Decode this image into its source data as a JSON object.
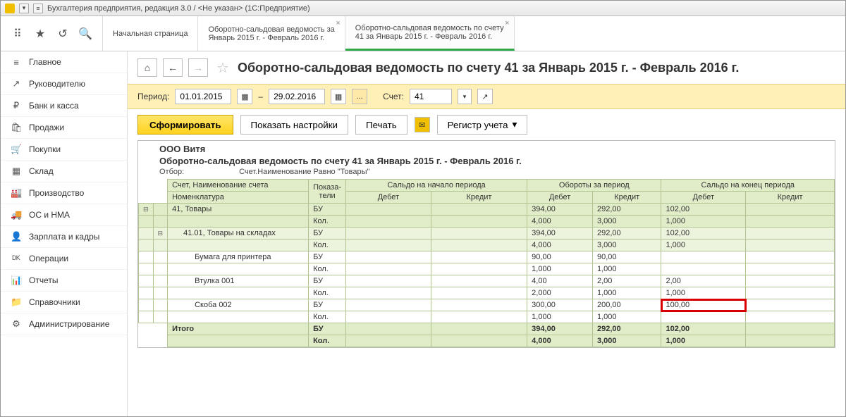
{
  "window_title": "Бухгалтерия предприятия, редакция 3.0 / <Не указан> (1С:Предприятие)",
  "toolbar_icons": [
    "grid",
    "star",
    "link",
    "search"
  ],
  "tabs": [
    {
      "l1": "Начальная страница",
      "l2": ""
    },
    {
      "l1": "Оборотно-сальдовая ведомость за",
      "l2": "Январь 2015 г. - Февраль 2016 г."
    },
    {
      "l1": "Оборотно-сальдовая ведомость по счету",
      "l2": "41 за Январь 2015 г. - Февраль 2016 г."
    }
  ],
  "sidebar": [
    {
      "icon": "≡",
      "label": "Главное"
    },
    {
      "icon": "↗",
      "label": "Руководителю"
    },
    {
      "icon": "₽",
      "label": "Банк и касса"
    },
    {
      "icon": "🛍",
      "label": "Продажи"
    },
    {
      "icon": "🛒",
      "label": "Покупки"
    },
    {
      "icon": "▦",
      "label": "Склад"
    },
    {
      "icon": "🏭",
      "label": "Производство"
    },
    {
      "icon": "🚚",
      "label": "ОС и НМА"
    },
    {
      "icon": "👤",
      "label": "Зарплата и кадры"
    },
    {
      "icon": "ᴰᴷ",
      "label": "Операции"
    },
    {
      "icon": "📊",
      "label": "Отчеты"
    },
    {
      "icon": "📁",
      "label": "Справочники"
    },
    {
      "icon": "⚙",
      "label": "Администрирование"
    }
  ],
  "page_title": "Оборотно-сальдовая ведомость по счету 41 за Январь 2015 г. - Февраль 2016 г.",
  "params": {
    "period_label": "Период:",
    "from": "01.01.2015",
    "dash": "–",
    "to": "29.02.2016",
    "dots": "...",
    "account_label": "Счет:",
    "account": "41"
  },
  "buttons": {
    "form": "Сформировать",
    "settings": "Показать настройки",
    "print": "Печать",
    "register": "Регистр учета"
  },
  "report": {
    "org": "ООО Витя",
    "title": "Оборотно-сальдовая ведомость по счету 41 за Январь 2015 г. - Февраль 2016 г.",
    "filter_label": "Отбор:",
    "filter_text": "Счет.Наименование Равно \"Товары\"",
    "header": {
      "acc_name": "Счет, Наименование счета",
      "nomen": "Номенклатура",
      "indic": "Показа-\nтели",
      "open": "Сальдо на начало периода",
      "turn": "Обороты за период",
      "close": "Сальдо на конец периода",
      "debit": "Дебет",
      "credit": "Кредит"
    },
    "rows": [
      {
        "depth": 0,
        "label": "41, Товары",
        "ind": "БУ",
        "od": "",
        "oc": "",
        "td": "394,00",
        "tc": "292,00",
        "cd": "102,00",
        "cc": ""
      },
      {
        "depth": 0,
        "label": "",
        "ind": "Кол.",
        "od": "",
        "oc": "",
        "td": "4,000",
        "tc": "3,000",
        "cd": "1,000",
        "cc": ""
      },
      {
        "depth": 1,
        "label": "41.01, Товары на складах",
        "ind": "БУ",
        "od": "",
        "oc": "",
        "td": "394,00",
        "tc": "292,00",
        "cd": "102,00",
        "cc": ""
      },
      {
        "depth": 1,
        "label": "",
        "ind": "Кол.",
        "od": "",
        "oc": "",
        "td": "4,000",
        "tc": "3,000",
        "cd": "1,000",
        "cc": ""
      },
      {
        "depth": 2,
        "label": "Бумага для принтера",
        "ind": "БУ",
        "od": "",
        "oc": "",
        "td": "90,00",
        "tc": "90,00",
        "cd": "",
        "cc": ""
      },
      {
        "depth": 2,
        "label": "",
        "ind": "Кол.",
        "od": "",
        "oc": "",
        "td": "1,000",
        "tc": "1,000",
        "cd": "",
        "cc": ""
      },
      {
        "depth": 2,
        "label": "Втулка 001",
        "ind": "БУ",
        "od": "",
        "oc": "",
        "td": "4,00",
        "tc": "2,00",
        "cd": "2,00",
        "cc": ""
      },
      {
        "depth": 2,
        "label": "",
        "ind": "Кол.",
        "od": "",
        "oc": "",
        "td": "2,000",
        "tc": "1,000",
        "cd": "1,000",
        "cc": ""
      },
      {
        "depth": 2,
        "label": "Скоба 002",
        "ind": "БУ",
        "od": "",
        "oc": "",
        "td": "300,00",
        "tc": "200,00",
        "cd": "100,00",
        "cc": "",
        "hl": true
      },
      {
        "depth": 2,
        "label": "",
        "ind": "Кол.",
        "od": "",
        "oc": "",
        "td": "1,000",
        "tc": "1,000",
        "cd": "",
        "cc": ""
      }
    ],
    "total_label": "Итого",
    "totals": [
      {
        "ind": "БУ",
        "od": "",
        "oc": "",
        "td": "394,00",
        "tc": "292,00",
        "cd": "102,00",
        "cc": ""
      },
      {
        "ind": "Кол.",
        "od": "",
        "oc": "",
        "td": "4,000",
        "tc": "3,000",
        "cd": "1,000",
        "cc": ""
      }
    ]
  }
}
